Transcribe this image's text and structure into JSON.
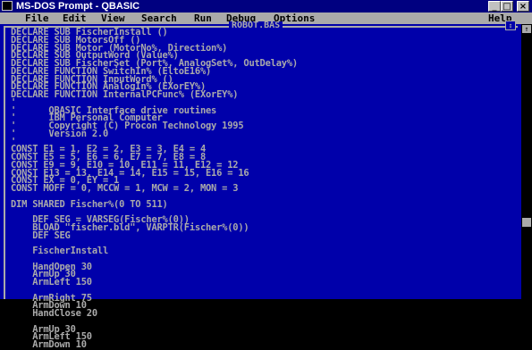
{
  "window": {
    "title": "MS-DOS Prompt - QBASIC",
    "controls": {
      "minimize": "_",
      "maximize": "□",
      "close": "×"
    }
  },
  "menu": {
    "items": [
      "File",
      "Edit",
      "View",
      "Search",
      "Run",
      "Debug",
      "Options"
    ],
    "help": "Help"
  },
  "editor": {
    "filename": "ROBOT.BAS",
    "lines": [
      "DECLARE SUB FischerInstall ()",
      "DECLARE SUB MotorsOff ()",
      "DECLARE SUB Motor (MotorNo%, Direction%)",
      "DECLARE SUB OutputWord (Value%)",
      "DECLARE SUB FischerSet (Port%, AnalogSet%, OutDelay%)",
      "DECLARE FUNCTION SwitchIn% (EltoE16%)",
      "DECLARE FUNCTION InputWord% ()",
      "DECLARE FUNCTION AnalogIn% (EXorEY%)",
      "DECLARE FUNCTION InternalPCFunc% (EXorEY%)",
      "'",
      "'      QBASIC Interface drive routines",
      "'      IBM Personal Computer",
      "'      Copyright (C) Procon Technology 1995",
      "'      Version 2.0",
      "'",
      "CONST E1 = 1, E2 = 2, E3 = 3, E4 = 4",
      "CONST E5 = 5, E6 = 6, E7 = 7, E8 = 8",
      "CONST E9 = 9, E10 = 10, E11 = 11, E12 = 12",
      "CONST E13 = 13, E14 = 14, E15 = 15, E16 = 16",
      "CONST EX = 0, EY = 1",
      "CONST MOFF = 0, MCCW = 1, MCW = 2, MON = 3",
      "",
      "DIM SHARED Fischer%(0 TO 511)",
      "",
      "    DEF SEG = VARSEG(Fischer%(0))",
      "    BLOAD \"fischer.bld\", VARPTR(Fischer%(0))",
      "    DEF SEG",
      "",
      "    FischerInstall",
      "",
      "    HandOpen 30",
      "    ArmUp 30",
      "    ArmLeft 150",
      "",
      "    ArmRight 75",
      "    ArmDown 10",
      "    HandClose 20",
      "",
      "    ArmUp 30",
      "    ArmLeft 150",
      "    ArmDown 10"
    ]
  },
  "scrollbar": {
    "up_arrow": "↑",
    "position": 0.72
  }
}
